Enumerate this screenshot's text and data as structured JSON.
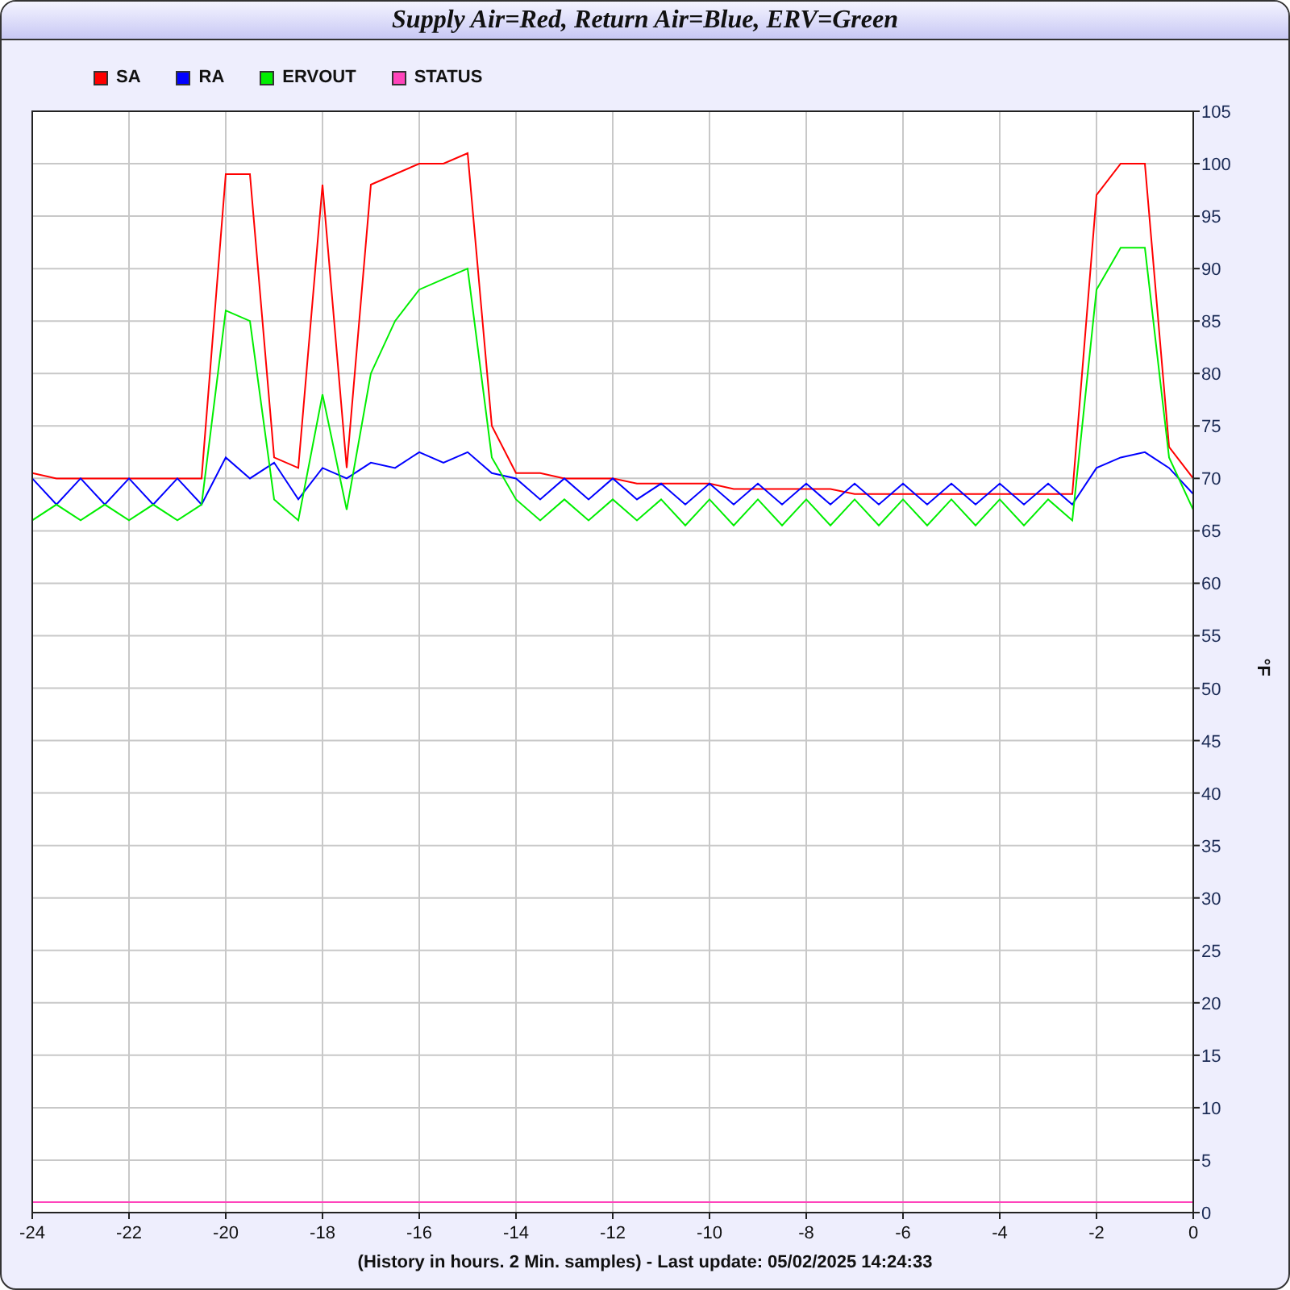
{
  "window": {
    "title": "Supply Air=Red, Return Air=Blue, ERV=Green"
  },
  "chart": {
    "chart_data": {
      "type": "line",
      "xlabel": "(History in hours. 2 Min. samples) - Last update: 05/02/2025 14:24:33",
      "ylabel": "°F",
      "x": [
        -24,
        -23.5,
        -23,
        -22.5,
        -22,
        -21.5,
        -21,
        -20.5,
        -20,
        -19.5,
        -19,
        -18.5,
        -18,
        -17.5,
        -17,
        -16.5,
        -16,
        -15.5,
        -15,
        -14.5,
        -14,
        -13.5,
        -13,
        -12.5,
        -12,
        -11.5,
        -11,
        -10.5,
        -10,
        -9.5,
        -9,
        -8.5,
        -8,
        -7.5,
        -7,
        -6.5,
        -6,
        -5.5,
        -5,
        -4.5,
        -4,
        -3.5,
        -3,
        -2.5,
        -2,
        -1.5,
        -1,
        -0.5,
        0
      ],
      "series": [
        {
          "name": "SA",
          "color": "#ff0000",
          "values": [
            70.5,
            70,
            70,
            70,
            70,
            70,
            70,
            70,
            99,
            99,
            72,
            71,
            98,
            71,
            98,
            99,
            100,
            100,
            101,
            75,
            70.5,
            70.5,
            70,
            70,
            70,
            69.5,
            69.5,
            69.5,
            69.5,
            69,
            69,
            69,
            69,
            69,
            68.5,
            68.5,
            68.5,
            68.5,
            68.5,
            68.5,
            68.5,
            68.5,
            68.5,
            68.5,
            97,
            100,
            100,
            73,
            70
          ]
        },
        {
          "name": "RA",
          "color": "#0000ff",
          "values": [
            70,
            67.5,
            70,
            67.5,
            70,
            67.5,
            70,
            67.5,
            72,
            70,
            71.5,
            68,
            71,
            70,
            71.5,
            71,
            72.5,
            71.5,
            72.5,
            70.5,
            70,
            68,
            70,
            68,
            70,
            68,
            69.5,
            67.5,
            69.5,
            67.5,
            69.5,
            67.5,
            69.5,
            67.5,
            69.5,
            67.5,
            69.5,
            67.5,
            69.5,
            67.5,
            69.5,
            67.5,
            69.5,
            67.5,
            71,
            72,
            72.5,
            71,
            68.5
          ]
        },
        {
          "name": "ERVOUT",
          "color": "#00ee00",
          "values": [
            66,
            67.5,
            66,
            67.5,
            66,
            67.5,
            66,
            67.5,
            86,
            85,
            68,
            66,
            78,
            67,
            80,
            85,
            88,
            89,
            90,
            72,
            68,
            66,
            68,
            66,
            68,
            66,
            68,
            65.5,
            68,
            65.5,
            68,
            65.5,
            68,
            65.5,
            68,
            65.5,
            68,
            65.5,
            68,
            65.5,
            68,
            65.5,
            68,
            66,
            88,
            92,
            92,
            72,
            67
          ]
        },
        {
          "name": "STATUS",
          "color": "#ff44bb",
          "values": [
            1,
            1,
            1,
            1,
            1,
            1,
            1,
            1,
            1,
            1,
            1,
            1,
            1,
            1,
            1,
            1,
            1,
            1,
            1,
            1,
            1,
            1,
            1,
            1,
            1,
            1,
            1,
            1,
            1,
            1,
            1,
            1,
            1,
            1,
            1,
            1,
            1,
            1,
            1,
            1,
            1,
            1,
            1,
            1,
            1,
            1,
            1,
            1,
            1
          ]
        }
      ],
      "grid": true,
      "xlim": [
        -24,
        0
      ],
      "ylim": [
        0,
        105
      ],
      "xticks": [
        -24,
        -22,
        -20,
        -18,
        -16,
        -14,
        -12,
        -10,
        -8,
        -6,
        -4,
        -2,
        0
      ],
      "yticks": [
        0,
        5,
        10,
        15,
        20,
        25,
        30,
        35,
        40,
        45,
        50,
        55,
        60,
        65,
        70,
        75,
        80,
        85,
        90,
        95,
        100,
        105
      ]
    }
  }
}
